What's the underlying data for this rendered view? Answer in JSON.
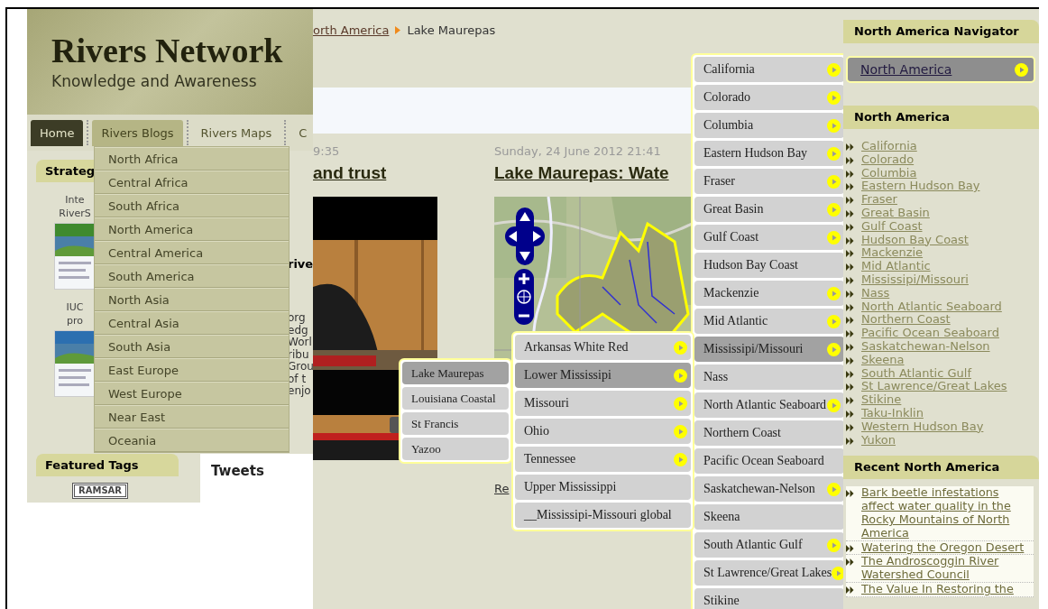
{
  "site": {
    "title": "Rivers Network",
    "tagline": "Knowledge and Awareness"
  },
  "nav": [
    {
      "label": "Home",
      "current": true,
      "expanded": false
    },
    {
      "label": "Rivers Blogs",
      "current": false,
      "expanded": true
    },
    {
      "label": "Rivers Maps",
      "current": false,
      "expanded": false
    },
    {
      "label": "C",
      "current": false,
      "expanded": false
    }
  ],
  "blogs_menu": [
    "North Africa",
    "Central Africa",
    "South Africa",
    "North America",
    "Central America",
    "South America",
    "North Asia",
    "Central Asia",
    "South Asia",
    "East Europe",
    "West Europe",
    "Near East",
    "Oceania"
  ],
  "left_sidebar": {
    "heading": "Strateg",
    "items": [
      {
        "caption": [
          "Inte",
          "RiverS"
        ]
      },
      {
        "caption": [
          "IUC",
          "pro"
        ]
      }
    ]
  },
  "post_fragments": {
    "heading": "rive",
    "lines": [
      "org",
      "edg",
      "Worl",
      "ribu",
      "Grou",
      "of t",
      "enjo"
    ]
  },
  "featured_tags": {
    "heading": "Featured Tags",
    "logo": "RAMSAR"
  },
  "tweets": {
    "heading": "Tweets"
  },
  "breadcrumb": {
    "link": "orth America",
    "current": "Lake Maurepas"
  },
  "posts": [
    {
      "date": "9:35",
      "title": "and trust"
    },
    {
      "date": "Sunday, 24 June 2012 21:41",
      "title": "Lake Maurepas: Wate",
      "read_more": "Re"
    }
  ],
  "watershed_menus": [
    {
      "items": [
        {
          "label": "California",
          "selected": false,
          "has_submenu": true
        },
        {
          "label": "Colorado",
          "selected": false,
          "has_submenu": true
        },
        {
          "label": "Columbia",
          "selected": false,
          "has_submenu": true
        },
        {
          "label": "Eastern Hudson Bay",
          "selected": false,
          "has_submenu": true
        },
        {
          "label": "Fraser",
          "selected": false,
          "has_submenu": true
        },
        {
          "label": "Great Basin",
          "selected": false,
          "has_submenu": true
        },
        {
          "label": "Gulf Coast",
          "selected": false,
          "has_submenu": true
        },
        {
          "label": "Hudson Bay Coast",
          "selected": false,
          "has_submenu": false
        },
        {
          "label": "Mackenzie",
          "selected": false,
          "has_submenu": true
        },
        {
          "label": "Mid Atlantic",
          "selected": false,
          "has_submenu": true
        },
        {
          "label": "Mississipi/Missouri",
          "selected": true,
          "has_submenu": true
        },
        {
          "label": "Nass",
          "selected": false,
          "has_submenu": false
        },
        {
          "label": "North Atlantic Seaboard",
          "selected": false,
          "has_submenu": true
        },
        {
          "label": "Northern Coast",
          "selected": false,
          "has_submenu": false
        },
        {
          "label": "Pacific Ocean Seaboard",
          "selected": false,
          "has_submenu": false
        },
        {
          "label": "Saskatchewan-Nelson",
          "selected": false,
          "has_submenu": true
        },
        {
          "label": "Skeena",
          "selected": false,
          "has_submenu": false
        },
        {
          "label": "South Atlantic Gulf",
          "selected": false,
          "has_submenu": true
        },
        {
          "label": "St Lawrence/Great Lakes",
          "selected": false,
          "has_submenu": true
        },
        {
          "label": "Stikine",
          "selected": false,
          "has_submenu": false
        }
      ]
    },
    {
      "items": [
        {
          "label": "Arkansas White Red",
          "selected": false,
          "has_submenu": true
        },
        {
          "label": "Lower Mississipi",
          "selected": true,
          "has_submenu": true
        },
        {
          "label": "Missouri",
          "selected": false,
          "has_submenu": true
        },
        {
          "label": "Ohio",
          "selected": false,
          "has_submenu": true
        },
        {
          "label": "Tennessee",
          "selected": false,
          "has_submenu": true
        },
        {
          "label": "Upper Mississippi",
          "selected": false,
          "has_submenu": false
        },
        {
          "label": "__Mississipi-Missouri global",
          "selected": false,
          "has_submenu": false
        }
      ]
    },
    {
      "items": [
        {
          "label": "Lake Maurepas",
          "selected": true,
          "has_submenu": false
        },
        {
          "label": "Louisiana Coastal",
          "selected": false,
          "has_submenu": false
        },
        {
          "label": "St Francis",
          "selected": false,
          "has_submenu": false
        },
        {
          "label": "Yazoo",
          "selected": false,
          "has_submenu": false
        }
      ]
    }
  ],
  "navigator": {
    "heading": "North America Navigator",
    "current": "North America"
  },
  "region_list": {
    "heading": "North America",
    "items": [
      "California",
      "Colorado",
      "Columbia",
      "Eastern Hudson Bay",
      "Fraser",
      "Great Basin",
      "Gulf Coast",
      "Hudson Bay Coast",
      "Mackenzie",
      "Mid Atlantic",
      "Mississipi/Missouri",
      "Nass",
      "North Atlantic Seaboard",
      "Northern Coast",
      "Pacific Ocean Seaboard",
      "Saskatchewan-Nelson",
      "Skeena",
      "South Atlantic Gulf",
      "St Lawrence/Great Lakes",
      "Stikine",
      "Taku-Inklin",
      "Western Hudson Bay",
      "Yukon"
    ]
  },
  "recent": {
    "heading": "Recent North America",
    "items": [
      "Bark beetle infestations affect water quality in the Rocky Mountains of North America",
      "Watering the Oregon Desert",
      "The Androscoggin River Watershed Council",
      "The Value In Restoring the"
    ]
  }
}
